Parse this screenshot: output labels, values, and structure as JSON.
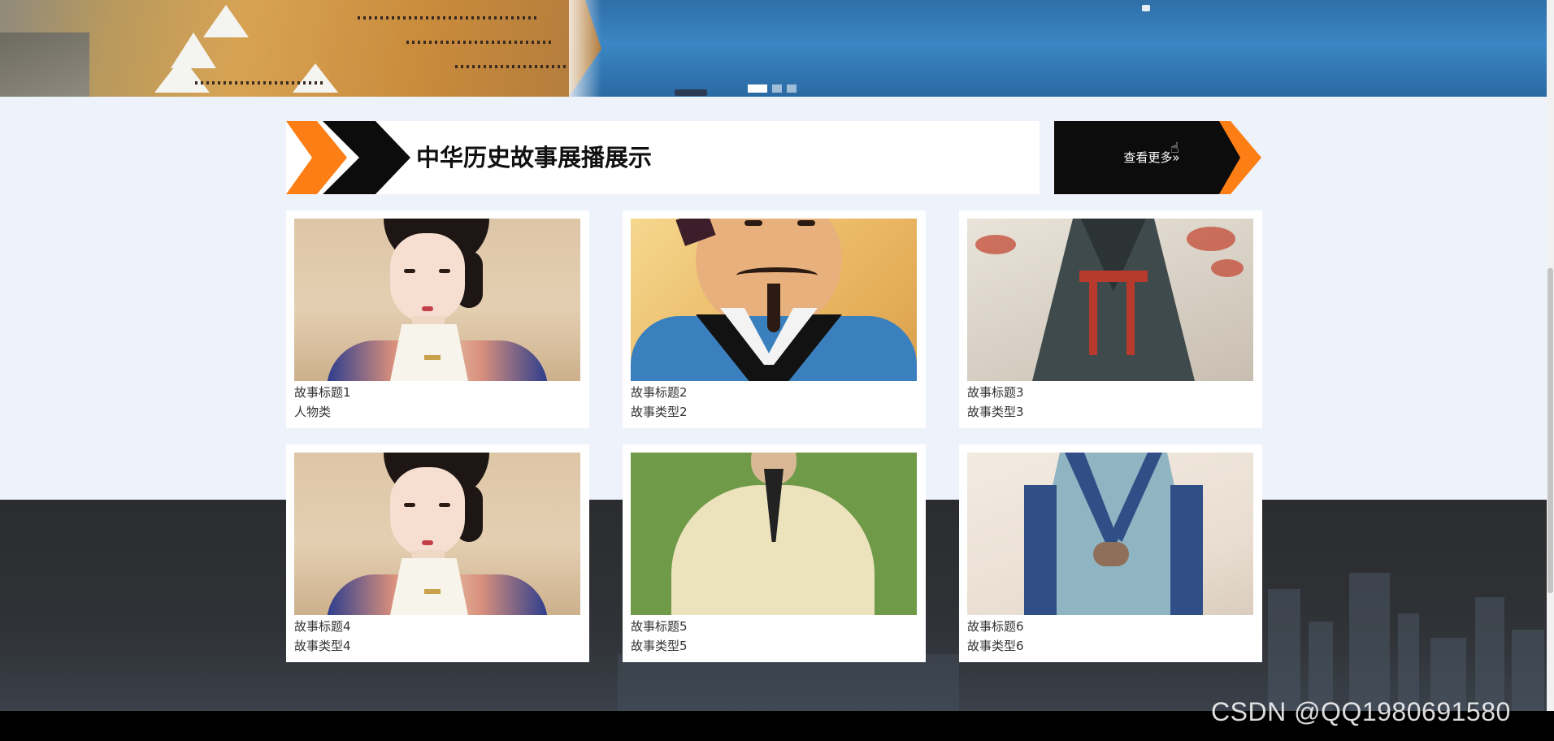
{
  "banner": {
    "slides": [
      {
        "name": "slide-1",
        "active": true
      },
      {
        "name": "slide-2",
        "active": false
      },
      {
        "name": "slide-3",
        "active": false
      }
    ]
  },
  "section": {
    "title": "中华历史故事展播展示",
    "more_label": "查看更多»"
  },
  "stories": [
    {
      "title": "故事标题1",
      "type": "人物类",
      "image": "woman-portrait"
    },
    {
      "title": "故事标题2",
      "type": "故事类型2",
      "image": "sage-portrait"
    },
    {
      "title": "故事标题3",
      "type": "故事类型3",
      "image": "robed-figure"
    },
    {
      "title": "故事标题4",
      "type": "故事类型4",
      "image": "woman-portrait"
    },
    {
      "title": "故事标题5",
      "type": "故事类型5",
      "image": "daoist-portrait"
    },
    {
      "title": "故事标题6",
      "type": "故事类型6",
      "image": "hanfu-figure"
    }
  ],
  "watermark": "CSDN @QQ1980691580",
  "colors": {
    "accent": "#fd7e14",
    "dark": "#0c0c0c",
    "page_bg": "#eef2fa",
    "footer_bg": "#2b2c2f"
  }
}
